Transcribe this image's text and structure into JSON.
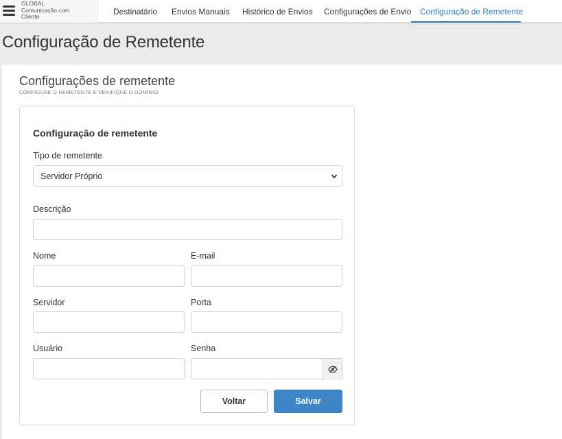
{
  "brand": {
    "line1": "GLOBAL",
    "line2": "Comunicação com",
    "line3": "Cliente",
    "menu_icon": "hamburger-icon"
  },
  "nav": {
    "items": [
      {
        "label": "Destinatário"
      },
      {
        "label": "Envios Manuais"
      },
      {
        "label": "Histórico de Envios"
      },
      {
        "label": "Configurações de Envio"
      },
      {
        "label": "Configuração de Remetente"
      }
    ],
    "active_index": 4,
    "accent_color": "#2f7bbf"
  },
  "page": {
    "title": "Configuração de Remetente"
  },
  "section": {
    "title": "Configurações de remetente",
    "subtitle": "CONFIGURE O REMETENTE E VERIFIQUE O DOMÍNIO"
  },
  "form": {
    "title": "Configuração de remetente",
    "tipo_label": "Tipo de remetente",
    "tipo_value": "Servidor Próprio",
    "descricao_label": "Descrição",
    "descricao_value": "",
    "nome_label": "Nome",
    "nome_value": "",
    "email_label": "E-mail",
    "email_value": "",
    "servidor_label": "Servidor",
    "servidor_value": "",
    "porta_label": "Porta",
    "porta_value": "",
    "usuario_label": "Usuário",
    "usuario_value": "",
    "senha_label": "Senha",
    "senha_value": "",
    "toggle_icon": "eye-slash-icon",
    "voltar_label": "Voltar",
    "salvar_label": "Salvar",
    "primary_color": "#3d85c6"
  }
}
